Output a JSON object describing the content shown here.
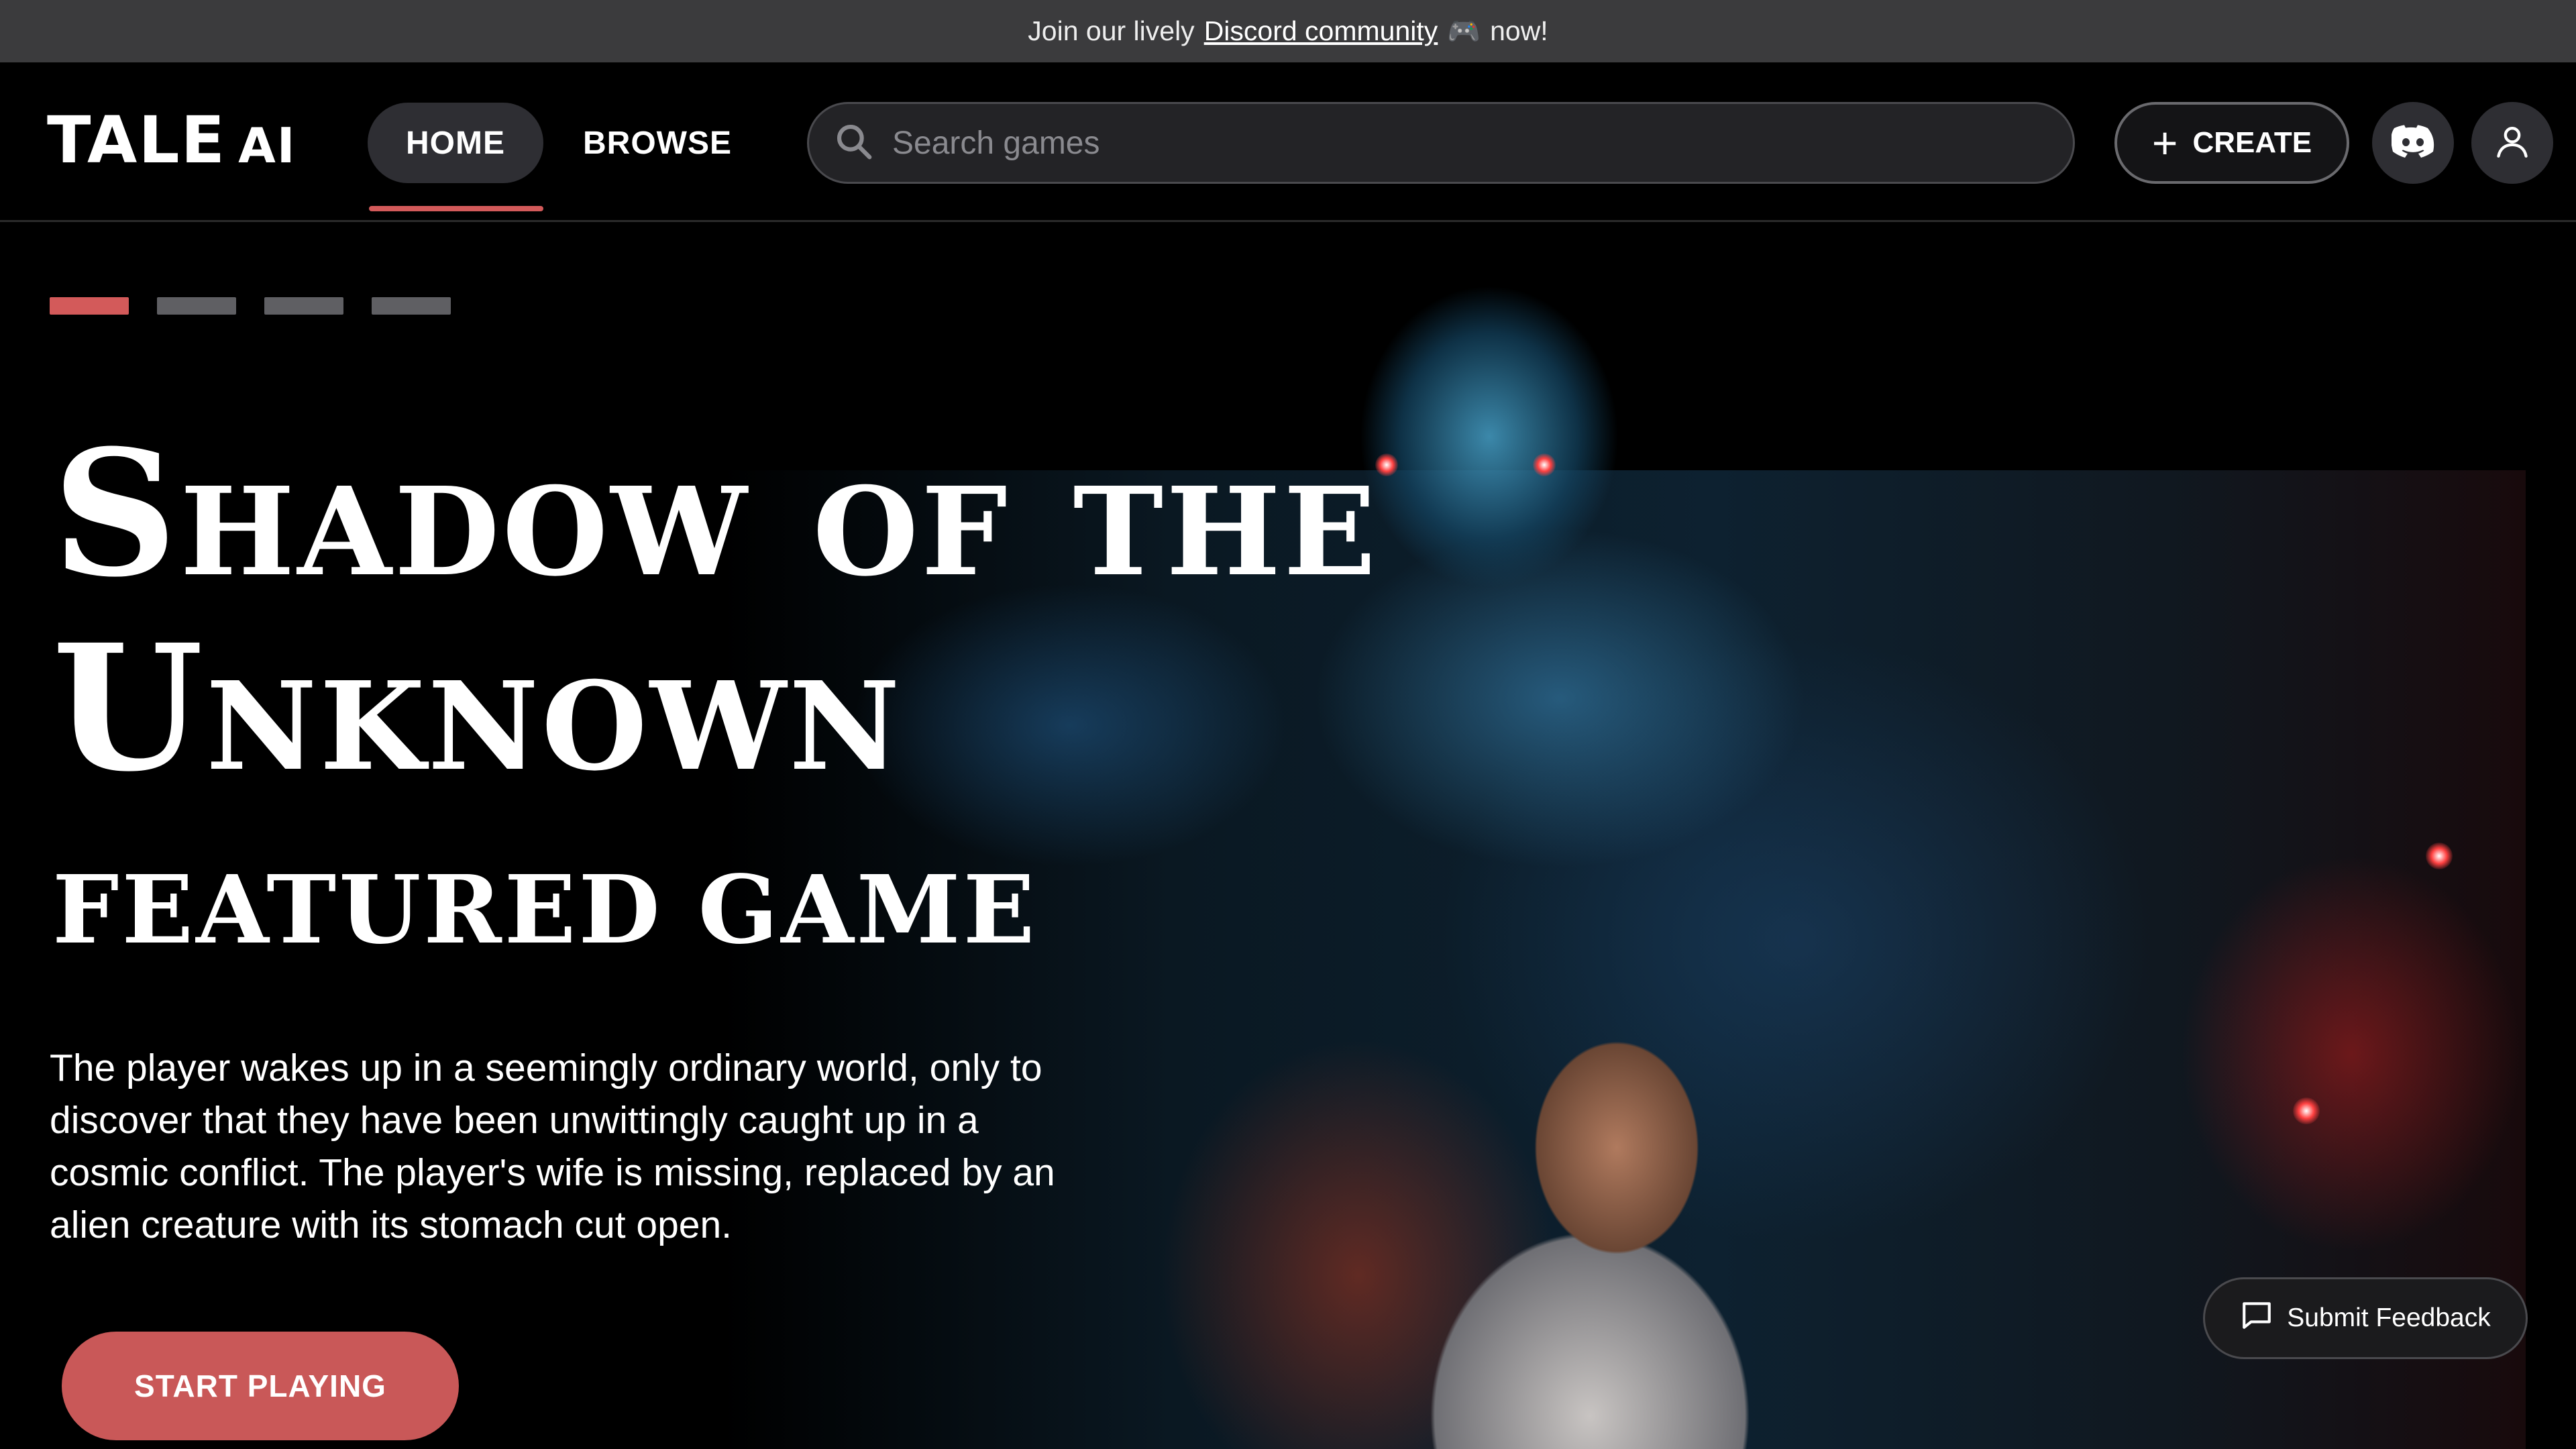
{
  "announcement": {
    "prefix": "Join our lively",
    "link_text": "Discord community",
    "emoji": "🎮",
    "suffix": "now!"
  },
  "header": {
    "logo_main": "TALE",
    "logo_suffix": "AI",
    "nav": [
      {
        "label": "HOME",
        "active": true
      },
      {
        "label": "BROWSE",
        "active": false
      }
    ],
    "search_placeholder": "Search games",
    "create_label": "CREATE",
    "icons": [
      "search-icon",
      "discord-icon",
      "user-icon"
    ]
  },
  "hero": {
    "slides_total": 4,
    "active_slide": 1,
    "title_line1": "Shadow of the",
    "title_line2": "Unknown",
    "label": "FEATURED GAME",
    "description": "The player wakes up in a seemingly ordinary world, only to discover that they have been unwittingly caught up in a cosmic conflict. The player's wife is missing, replaced by an alien creature with its stomach cut open.",
    "cta_label": "START PLAYING"
  },
  "feedback": {
    "label": "Submit Feedback"
  },
  "colors": {
    "accent": "#d35a5a",
    "background": "#000000",
    "announcement_bg": "#3b3b3d"
  }
}
